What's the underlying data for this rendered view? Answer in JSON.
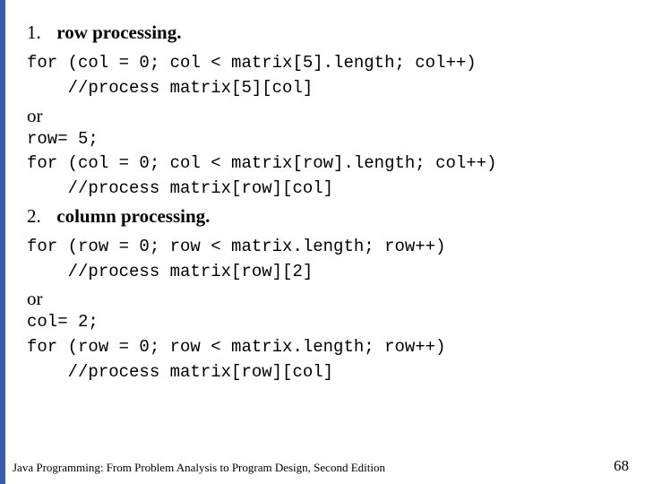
{
  "sections": {
    "s1": {
      "num": "1.",
      "title": "row processing."
    },
    "s2": {
      "num": "2.",
      "title": "column processing."
    }
  },
  "code": {
    "c1a": "for (col = 0; col < matrix[5].length; col++)",
    "c1b": "    //process matrix[5][col]",
    "c2a": "row= 5;",
    "c2b": "for (col = 0; col < matrix[row].length; col++)",
    "c2c": "    //process matrix[row][col]",
    "c3a": "for (row = 0; row < matrix.length; row++)",
    "c3b": "    //process matrix[row][2]",
    "c4a": "col= 2;",
    "c4b": "for (row = 0; row < matrix.length; row++)",
    "c4c": "    //process matrix[row][col]"
  },
  "or_label": "or",
  "footer": "Java Programming: From Problem Analysis to Program Design, Second Edition",
  "page_number": "68"
}
